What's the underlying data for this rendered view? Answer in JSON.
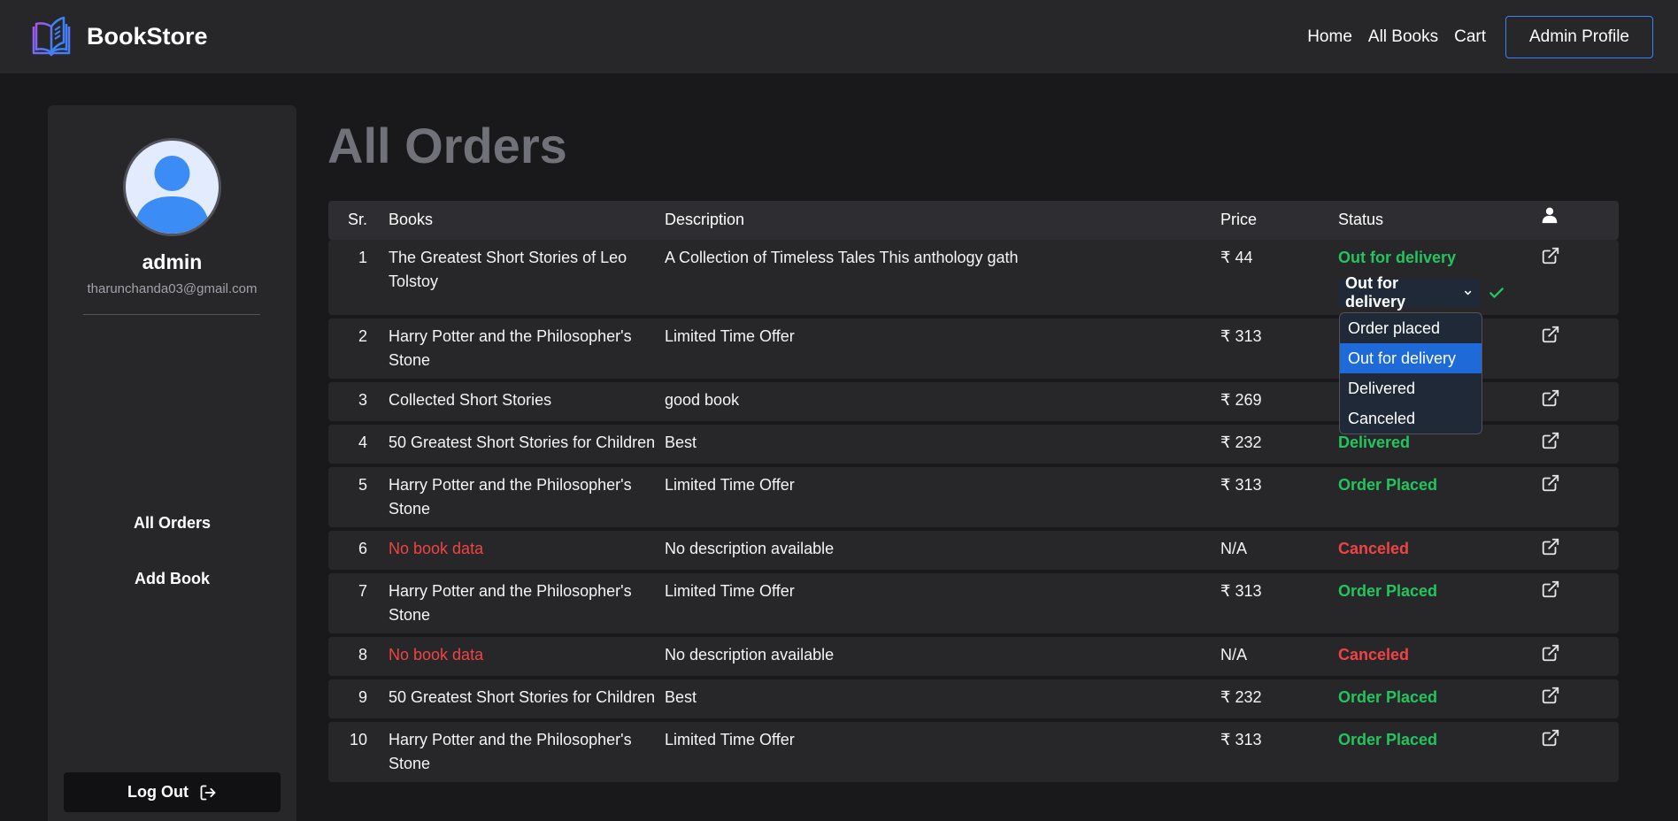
{
  "navbar": {
    "brand": "BookStore",
    "links": [
      "Home",
      "All Books",
      "Cart"
    ],
    "admin_button": "Admin Profile"
  },
  "sidebar": {
    "name": "admin",
    "email": "tharunchanda03@gmail.com",
    "links": [
      "All Orders",
      "Add Book"
    ],
    "logout": "Log Out"
  },
  "page_title": "All Orders",
  "table": {
    "headers": {
      "sr": "Sr.",
      "books": "Books",
      "description": "Description",
      "price": "Price",
      "status": "Status"
    },
    "rows": [
      {
        "sr": "1",
        "book": "The Greatest Short Stories of Leo Tolstoy",
        "desc": "A Collection of Timeless Tales This anthology gath",
        "price": "₹ 44",
        "status": "Out for delivery",
        "book_color": "default",
        "status_color": "green"
      },
      {
        "sr": "2",
        "book": "Harry Potter and the Philosopher's Stone",
        "desc": "Limited Time Offer",
        "price": "₹ 313",
        "status": "",
        "book_color": "default",
        "status_color": "green"
      },
      {
        "sr": "3",
        "book": "Collected Short Stories",
        "desc": "good book",
        "price": "₹ 269",
        "status": "",
        "book_color": "default",
        "status_color": "green"
      },
      {
        "sr": "4",
        "book": "50 Greatest Short Stories for Children",
        "desc": "Best",
        "price": "₹ 232",
        "status": "Delivered",
        "book_color": "default",
        "status_color": "green"
      },
      {
        "sr": "5",
        "book": "Harry Potter and the Philosopher's Stone",
        "desc": "Limited Time Offer",
        "price": "₹ 313",
        "status": "Order Placed",
        "book_color": "default",
        "status_color": "green"
      },
      {
        "sr": "6",
        "book": "No book data",
        "desc": "No description available",
        "price": "N/A",
        "status": "Canceled",
        "book_color": "red",
        "status_color": "red"
      },
      {
        "sr": "7",
        "book": "Harry Potter and the Philosopher's Stone",
        "desc": "Limited Time Offer",
        "price": "₹ 313",
        "status": "Order Placed",
        "book_color": "default",
        "status_color": "green"
      },
      {
        "sr": "8",
        "book": "No book data",
        "desc": "No description available",
        "price": "N/A",
        "status": "Canceled",
        "book_color": "red",
        "status_color": "red"
      },
      {
        "sr": "9",
        "book": "50 Greatest Short Stories for Children",
        "desc": "Best",
        "price": "₹ 232",
        "status": "Order Placed",
        "book_color": "default",
        "status_color": "green"
      },
      {
        "sr": "10",
        "book": "Harry Potter and the Philosopher's Stone",
        "desc": "Limited Time Offer",
        "price": "₹ 313",
        "status": "Order Placed",
        "book_color": "default",
        "status_color": "green"
      }
    ]
  },
  "status_editor": {
    "selected": "Out for delivery",
    "options": [
      "Order placed",
      "Out for delivery",
      "Delivered",
      "Canceled"
    ],
    "highlighted_index": 1
  },
  "colors": {
    "accent": "#3b82f6",
    "success": "#22c55e",
    "danger": "#ef4444",
    "highlight": "#1d6ad8"
  },
  "icons": {
    "header_user": "user-icon",
    "row_action": "external-link-icon",
    "confirm": "check-icon",
    "logout": "logout-icon"
  }
}
